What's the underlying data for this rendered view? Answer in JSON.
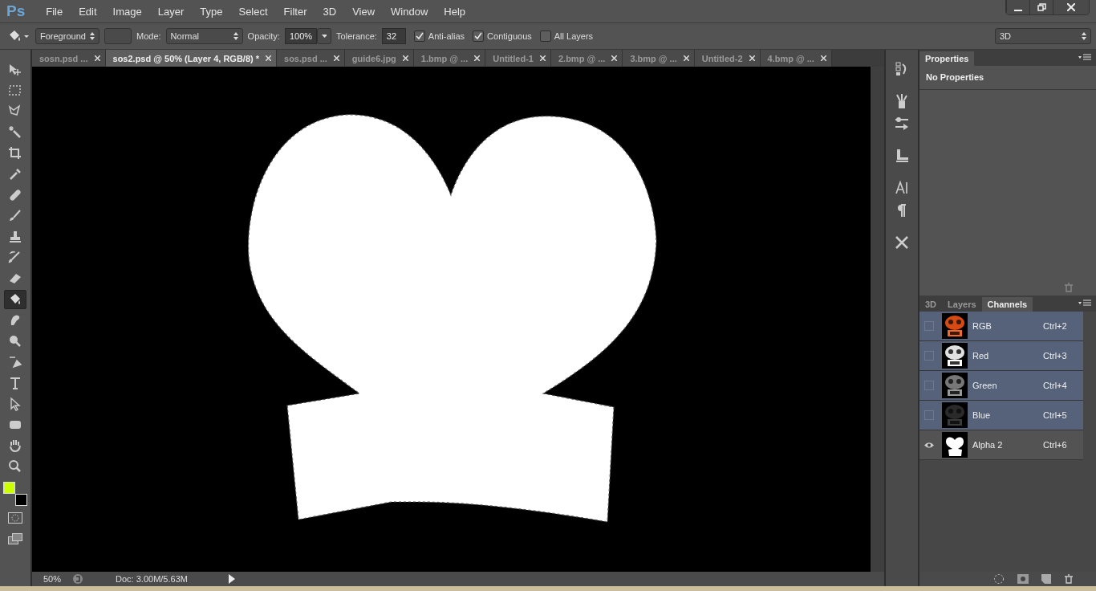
{
  "app": {
    "logo": "Ps"
  },
  "menu": [
    "File",
    "Edit",
    "Image",
    "Layer",
    "Type",
    "Select",
    "Filter",
    "3D",
    "View",
    "Window",
    "Help"
  ],
  "options": {
    "fill_source": "Foreground",
    "mode_label": "Mode:",
    "mode": "Normal",
    "opacity_label": "Opacity:",
    "opacity": "100%",
    "tolerance_label": "Tolerance:",
    "tolerance": "32",
    "checks": [
      {
        "label": "Anti-alias",
        "checked": true
      },
      {
        "label": "Contiguous",
        "checked": true
      },
      {
        "label": "All Layers",
        "checked": false
      }
    ],
    "workspace": "3D"
  },
  "tabs": [
    {
      "label": "sosn.psd ...",
      "selected": false
    },
    {
      "label": "sos2.psd @ 50% (Layer 4, RGB/8) *",
      "selected": true
    },
    {
      "label": "sos.psd ...",
      "selected": false
    },
    {
      "label": "guide6.jpg",
      "selected": false
    },
    {
      "label": "1.bmp @ ...",
      "selected": false
    },
    {
      "label": "Untitled-1",
      "selected": false
    },
    {
      "label": "2.bmp @ ...",
      "selected": false
    },
    {
      "label": "3.bmp @ ...",
      "selected": false
    },
    {
      "label": "Untitled-2",
      "selected": false
    },
    {
      "label": "4.bmp @ ...",
      "selected": false
    }
  ],
  "tools": [
    {
      "kind": "move",
      "selected": false
    },
    {
      "kind": "marquee",
      "selected": false
    },
    {
      "kind": "lasso",
      "selected": false
    },
    {
      "kind": "wand",
      "selected": false
    },
    {
      "kind": "crop",
      "selected": false
    },
    {
      "kind": "eyedropper",
      "selected": false
    },
    {
      "kind": "healing",
      "selected": false
    },
    {
      "kind": "brush",
      "selected": false
    },
    {
      "kind": "stamp",
      "selected": false
    },
    {
      "kind": "history-brush",
      "selected": false
    },
    {
      "kind": "eraser",
      "selected": false
    },
    {
      "kind": "bucket",
      "selected": true
    },
    {
      "kind": "smudge",
      "selected": false
    },
    {
      "kind": "dodge",
      "selected": false
    },
    {
      "kind": "pen",
      "selected": false
    },
    {
      "kind": "type",
      "selected": false
    },
    {
      "kind": "path-select",
      "selected": false
    },
    {
      "kind": "shape",
      "selected": false
    },
    {
      "kind": "hand",
      "selected": false
    },
    {
      "kind": "zoom",
      "selected": false
    }
  ],
  "swatches": [
    {
      "kind": "background",
      "color": "#000000"
    },
    {
      "kind": "foreground",
      "color": "#ccff00"
    }
  ],
  "status": {
    "zoom": "50%",
    "doc": "Doc: 3.00M/5.63M"
  },
  "properties": {
    "tab": "Properties",
    "message": "No Properties"
  },
  "channels_panel": {
    "tabs": [
      {
        "label": "3D",
        "selected": false
      },
      {
        "label": "Layers",
        "selected": false
      },
      {
        "label": "Channels",
        "selected": true
      }
    ],
    "channels": [
      {
        "name": "RGB",
        "shortcut": "Ctrl+2",
        "kind": "rgb",
        "selected": true,
        "visible": false
      },
      {
        "name": "Red",
        "shortcut": "Ctrl+3",
        "kind": "red",
        "selected": true,
        "visible": false
      },
      {
        "name": "Green",
        "shortcut": "Ctrl+4",
        "kind": "green",
        "selected": true,
        "visible": false
      },
      {
        "name": "Blue",
        "shortcut": "Ctrl+5",
        "kind": "blue",
        "selected": true,
        "visible": false
      },
      {
        "name": "Alpha 2",
        "shortcut": "Ctrl+6",
        "kind": "mask",
        "selected": false,
        "visible": true
      }
    ]
  }
}
